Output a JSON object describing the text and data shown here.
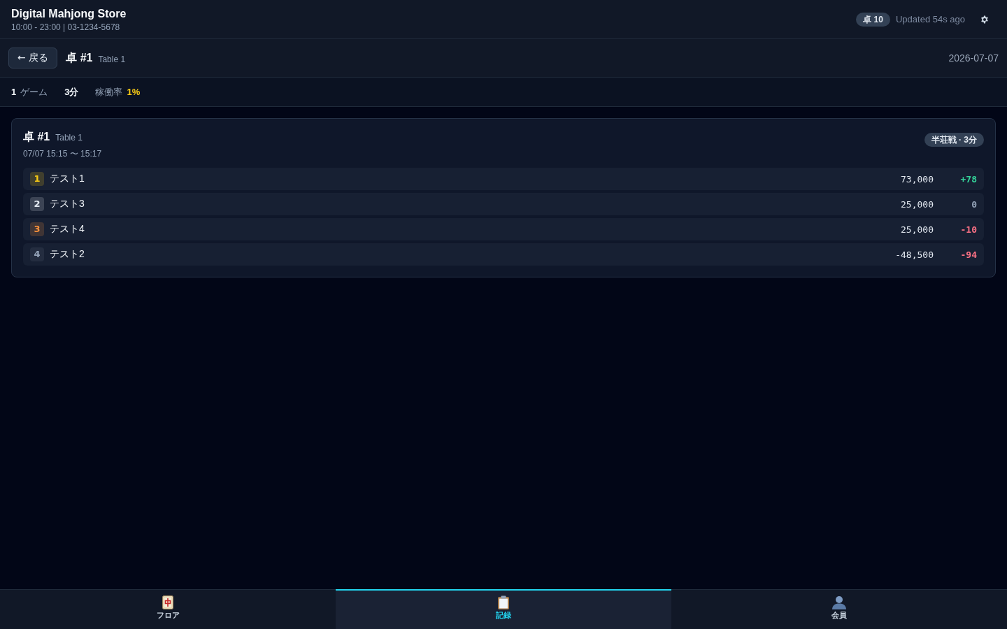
{
  "header": {
    "title": "Digital Mahjong Store",
    "subtitle": "10:00 - 23:00 | 03-1234-5678",
    "table_count": "卓 10",
    "updated": "Updated 54s ago"
  },
  "subheader": {
    "back_button": "← 戻る",
    "title": "卓 #1",
    "subtitle": "Table 1",
    "date": "2026-07-07"
  },
  "stats": [
    {
      "kind": "count",
      "value": "1",
      "label": "ゲーム"
    },
    {
      "kind": "plain",
      "value": "3分"
    },
    {
      "kind": "rate",
      "label": "稼働率",
      "value": "1%"
    }
  ],
  "game_card": {
    "title": "卓 #1",
    "subtitle": "Table 1",
    "time": "07/07 15:15 〜 15:17",
    "badge": "半荘戦 · 3分",
    "results": [
      {
        "rank": "1",
        "color": "#facc15",
        "name": "テスト1",
        "score": "73,000",
        "delta": "+78",
        "kind": "plus"
      },
      {
        "rank": "2",
        "color": "#e2e8f0",
        "name": "テスト3",
        "score": "25,000",
        "delta": "0",
        "kind": "zero"
      },
      {
        "rank": "3",
        "color": "#fb923c",
        "name": "テスト4",
        "score": "25,000",
        "delta": "-10",
        "kind": "minus"
      },
      {
        "rank": "4",
        "color": "#94a3b8",
        "name": "テスト2",
        "score": "-48,500",
        "delta": "-94",
        "kind": "minus"
      }
    ]
  },
  "nav": [
    {
      "kind": "tile",
      "label": "フロア",
      "selected": false
    },
    {
      "kind": "clipboard",
      "label": "記録",
      "selected": true
    },
    {
      "kind": "person",
      "label": "会員",
      "selected": false
    }
  ]
}
